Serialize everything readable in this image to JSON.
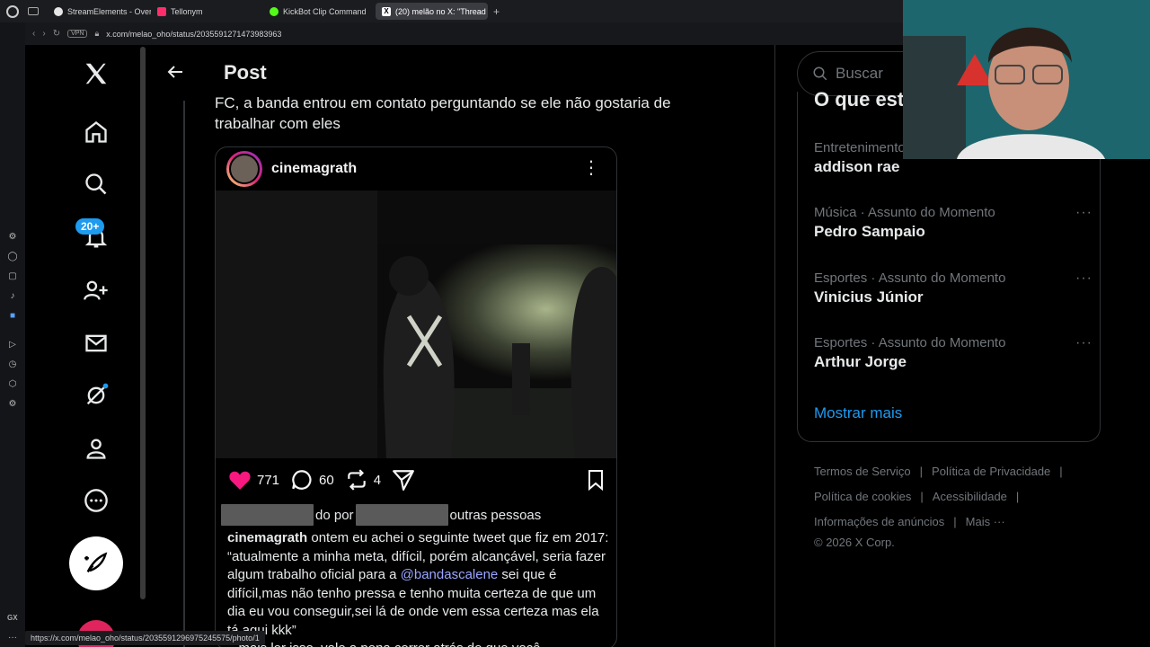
{
  "browser": {
    "tabs": [
      {
        "label": "StreamElements - Overlay",
        "color": "#9aa0a6"
      },
      {
        "label": "Tellonym",
        "color": "#ff2e6b"
      },
      {
        "label": "KickBot Clip Command",
        "color": "#53fc18"
      },
      {
        "label": "(20) melão no X: \"Thread",
        "color": "#ffffff"
      }
    ],
    "vpn_label": "VPN",
    "url": "x.com/melao_oho/status/2035591271473983963",
    "status_url": "https://x.com/melao_oho/status/2035591296975245575/photo/1",
    "gx_label": "GX"
  },
  "x_nav": {
    "notification_badge": "20+",
    "items": [
      "home",
      "explore",
      "notifications",
      "follow",
      "messages",
      "grok",
      "profile",
      "more"
    ]
  },
  "post": {
    "header_title": "Post",
    "text": "FC, a banda entrou em contato perguntando se ele não gostaria de trabalhar com eles",
    "embed": {
      "username": "cinemagrath",
      "likes": "771",
      "comments": "60",
      "reposts": "4",
      "liked_by_mid": "do por",
      "liked_by_end": "outras pessoas",
      "caption_user": "cinemagrath",
      "caption_part1": " ontem eu achei o seguinte tweet que fiz em 2017: “atualmente a minha meta, difícil, porém alcançável, seria fazer algum trabalho oficial para a ",
      "caption_mention": "@bandascalene",
      "caption_part2": " sei que é difícil,mas não tenho pressa e tenho muita certeza de que um dia eu vou conseguir,sei lá de onde vem essa certeza mas ela tá aqui kkk”",
      "caption_part3": "...mais ler isso, vale a pena correr atrás do que você"
    }
  },
  "sidebar": {
    "search_placeholder": "Buscar",
    "trends_heading": "O que está acontecendo",
    "trends": [
      {
        "category": "Entretenimento · Assunto do Momento",
        "name": "addison rae"
      },
      {
        "category": "Música · Assunto do Momento",
        "name": "Pedro Sampaio"
      },
      {
        "category": "Esportes · Assunto do Momento",
        "name": "Vinicius Júnior"
      },
      {
        "category": "Esportes · Assunto do Momento",
        "name": "Arthur Jorge"
      }
    ],
    "show_more": "Mostrar mais",
    "footer": {
      "terms": "Termos de Serviço",
      "privacy": "Política de Privacidade",
      "cookies": "Política de cookies",
      "accessibility": "Acessibilidade",
      "ads": "Informações de anúncios",
      "more": "Mais ···",
      "copyright": "© 2026 X Corp."
    }
  },
  "colors": {
    "accent": "#1d9bf0",
    "like_red": "#f91880",
    "mention": "#9aa6ff"
  }
}
